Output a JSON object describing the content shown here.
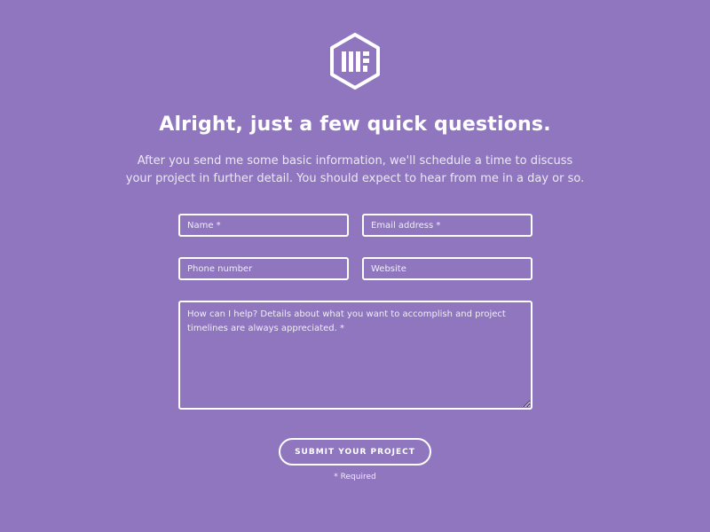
{
  "logo": {
    "icon": "hexagon-monogram-logo"
  },
  "header": {
    "title": "Alright, just a few quick questions.",
    "intro": "After you send me some basic information, we'll schedule a time to discuss your project in further detail. You should expect to hear from me in a day or so."
  },
  "form": {
    "name_placeholder": "Name *",
    "email_placeholder": "Email address *",
    "phone_placeholder": "Phone number",
    "website_placeholder": "Website",
    "message_placeholder": "How can I help? Details about what you want to accomplish and project timelines are always appreciated. *",
    "submit_label": "SUBMIT YOUR PROJECT",
    "required_note": "* Required"
  },
  "colors": {
    "background": "#8f76bf",
    "foreground": "#ffffff"
  }
}
